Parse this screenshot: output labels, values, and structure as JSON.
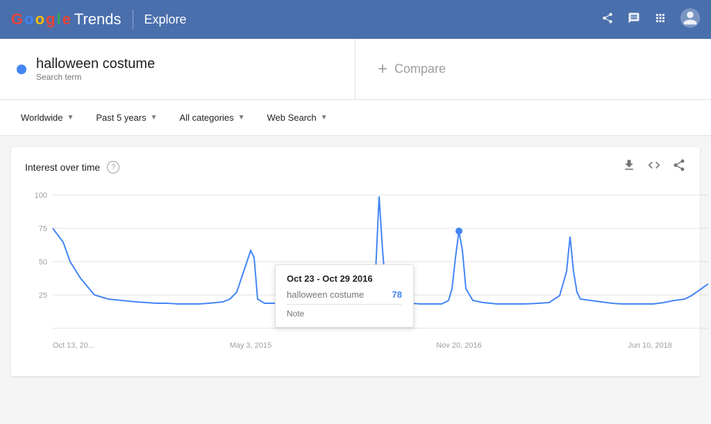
{
  "header": {
    "logo": {
      "google": "Google",
      "trends": "Trends"
    },
    "nav_label": "Explore",
    "icons": {
      "share": "⬆",
      "notifications": "🔔",
      "apps": "⠿",
      "account": "👤"
    }
  },
  "search": {
    "term": "halloween costume",
    "type": "Search term",
    "compare_label": "Compare"
  },
  "filters": {
    "location": "Worldwide",
    "time": "Past 5 years",
    "category": "All categories",
    "search_type": "Web Search"
  },
  "chart": {
    "title": "Interest over time",
    "help_icon": "?",
    "actions": {
      "download": "↓",
      "embed": "<>",
      "share": "⬆"
    },
    "x_labels": [
      "Oct 13, 20...",
      "May 3, 2015",
      "Nov 20, 2016",
      "Jun 10, 2018"
    ],
    "y_labels": [
      "100",
      "75",
      "50",
      "25"
    ],
    "tooltip": {
      "date_range": "Oct 23 - Oct 29 2016",
      "term": "halloween costume",
      "value": "78",
      "note_label": "Note"
    }
  }
}
